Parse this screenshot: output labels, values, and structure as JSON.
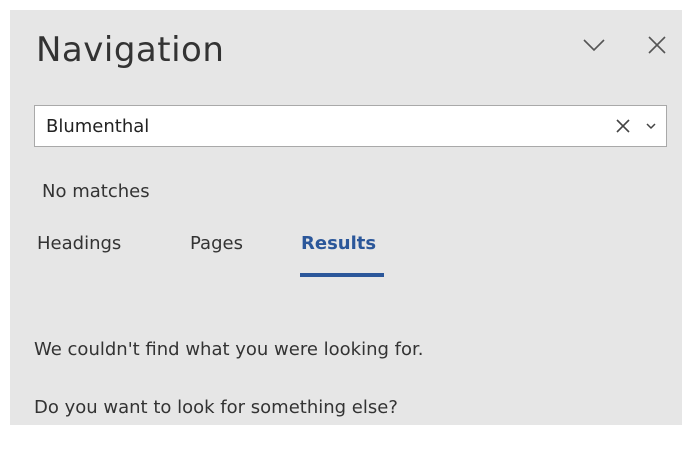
{
  "pane": {
    "title": "Navigation",
    "options_icon": "chevron-down-icon",
    "close_icon": "close-icon"
  },
  "search": {
    "value": "Blumenthal",
    "placeholder": "",
    "clear_icon": "clear-icon",
    "dropdown_icon": "small-chevron-down-icon"
  },
  "status": {
    "text": "No matches"
  },
  "tabs": [
    {
      "label": "Headings",
      "selected": false
    },
    {
      "label": "Pages",
      "selected": false
    },
    {
      "label": "Results",
      "selected": true
    }
  ],
  "results": {
    "message_1": "We couldn't find what you were looking for.",
    "message_2": "Do you want to look for something else?"
  },
  "colors": {
    "pane_background": "#e6e6e6",
    "accent": "#2b579a",
    "text": "#333333"
  }
}
